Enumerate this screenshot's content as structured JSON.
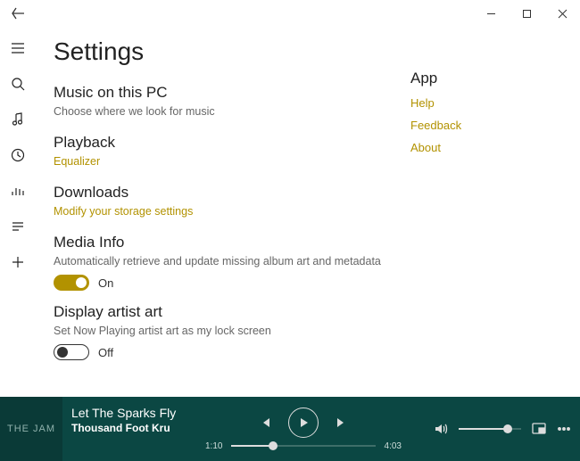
{
  "page": {
    "title": "Settings"
  },
  "sections": {
    "music": {
      "title": "Music on this PC",
      "subtitle": "Choose where we look for music"
    },
    "playback": {
      "title": "Playback",
      "link": "Equalizer"
    },
    "downloads": {
      "title": "Downloads",
      "link": "Modify your storage settings"
    },
    "media": {
      "title": "Media Info",
      "subtitle": "Automatically retrieve and update missing album art and metadata",
      "toggle_state": "on",
      "toggle_label": "On"
    },
    "artist": {
      "title": "Display artist art",
      "subtitle": "Set Now Playing artist art as my lock screen",
      "toggle_state": "off",
      "toggle_label": "Off"
    }
  },
  "app_section": {
    "title": "App",
    "links": [
      "Help",
      "Feedback",
      "About"
    ]
  },
  "player": {
    "art_text": "THE\nJAM",
    "track": "Let The Sparks Fly",
    "artist": "Thousand Foot Kru",
    "elapsed": "1:10",
    "total": "4:03",
    "progress_pct": 29,
    "volume_pct": 78
  },
  "colors": {
    "accent": "#B29200",
    "player_bg": "#0B4743"
  }
}
